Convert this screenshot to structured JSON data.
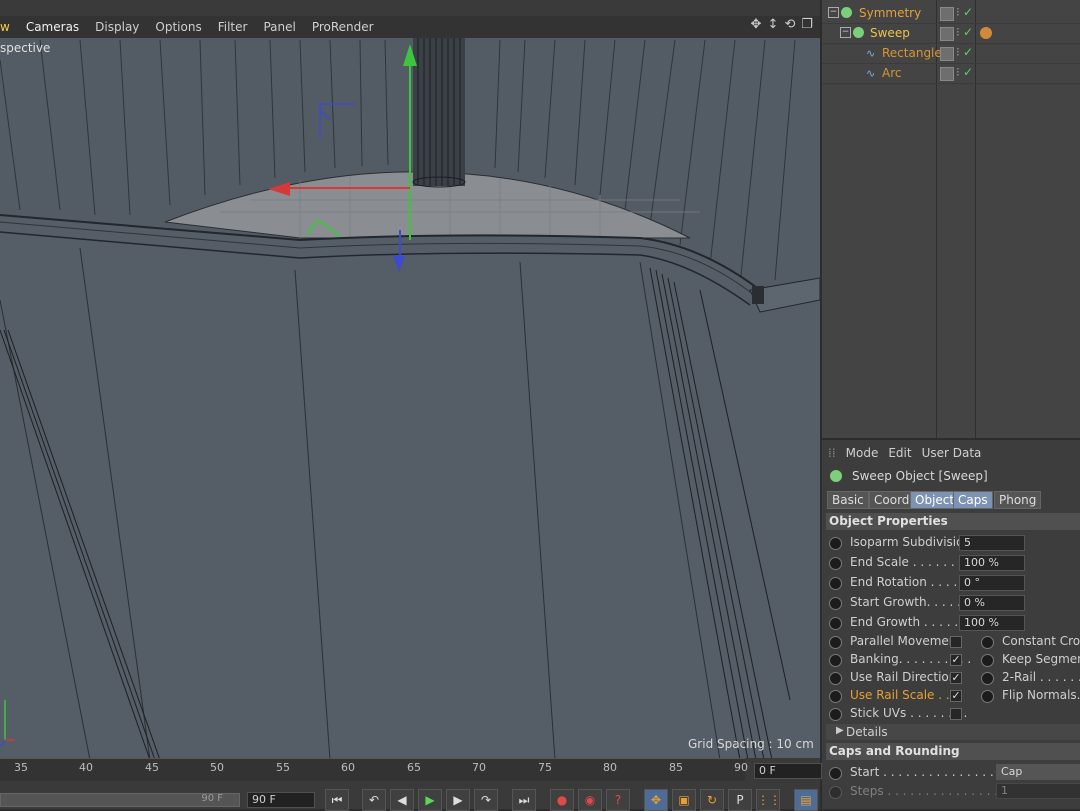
{
  "viewport": {
    "menu": [
      "w",
      "Cameras",
      "Display",
      "Options",
      "Filter",
      "Panel",
      "ProRender"
    ],
    "label": "spective",
    "grid_spacing": "Grid Spacing : 10 cm"
  },
  "timeline": {
    "ticks": [
      "35",
      "40",
      "45",
      "50",
      "55",
      "60",
      "65",
      "70",
      "75",
      "80",
      "85",
      "90"
    ],
    "frame_field": "0 F",
    "end_frame_small": "90 F",
    "end_frame": "90 F"
  },
  "objects": [
    {
      "name": "Symmetry",
      "color": "#e5a13a"
    },
    {
      "name": "Sweep",
      "color": "#f0c24a"
    },
    {
      "name": "Rectangle",
      "color": "#d59632"
    },
    {
      "name": "Arc",
      "color": "#d59632"
    }
  ],
  "attributes": {
    "menu": [
      "Mode",
      "Edit",
      "User Data"
    ],
    "title": "Sweep Object [Sweep]",
    "tabs": [
      "Basic",
      "Coord.",
      "Object",
      "Caps",
      "Phong"
    ],
    "section_object": "Object Properties",
    "props": [
      {
        "label": "Isoparm Subdivision",
        "value": "5"
      },
      {
        "label": "End Scale . . . . . . . . .",
        "value": "100 %"
      },
      {
        "label": "End Rotation . . . . . .",
        "value": "0 °"
      },
      {
        "label": "Start Growth. . . . . . .",
        "value": "0 %"
      },
      {
        "label": "End Growth . . . . . . .",
        "value": "100 %"
      }
    ],
    "checks_left": [
      {
        "label": "Parallel Movement",
        "checked": false
      },
      {
        "label": "Banking. . . . . . . . . .",
        "checked": true
      },
      {
        "label": "Use Rail Direction",
        "checked": true
      },
      {
        "label": "Use Rail Scale . . .",
        "checked": true
      },
      {
        "label": "Stick UVs . . . . . . . .",
        "checked": false
      }
    ],
    "checks_right": [
      "Constant Cross",
      "Keep Segments",
      "2-Rail . . . . . . .",
      "Flip Normals. ."
    ],
    "details": "Details",
    "section_caps": "Caps and Rounding",
    "caps_start_label": "Start . . . . . . . . . . . . . . . . . .",
    "caps_start_value": "Cap",
    "caps_steps_label": "Steps . . . . . . . . . . . . . . . . . .",
    "caps_steps_value": "1"
  }
}
